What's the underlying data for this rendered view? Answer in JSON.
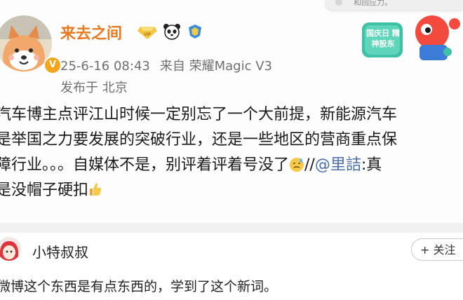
{
  "post": {
    "username": "来去之间",
    "timestamp": "25-6-16 08:43",
    "source_prefix": "来自",
    "device": "荣耀Magic V3",
    "location": "发布于 北京",
    "promo_text": "国庆日 精神股东",
    "content": {
      "line1": "汽车博主点评江山时候一定别忘了一个大前提，新能源汽车",
      "line2": "是举国之力要发展的突破行业，还是一些地区的营商重点保",
      "line3_a": "障行业。。。自媒体不是，别评着评着号没了",
      "line3_b": "//",
      "line3_mention": "@里詰",
      "line3_c": ":真",
      "line4": "是没帽子硬扣"
    },
    "badges": [
      "vip-diamond-icon",
      "panda-icon",
      "verified-shield-icon"
    ]
  },
  "top_notification": {
    "text": "和回应力。"
  },
  "comment": {
    "username": "小特叔叔",
    "follow_label": "+ 关注",
    "text": "微博这个东西是有点东西的，学到了这个新词。"
  },
  "colors": {
    "username": "#e8791e",
    "meta": "#6f6f6f",
    "mention": "#4a6ea8",
    "divider": "#f1f1f1"
  }
}
